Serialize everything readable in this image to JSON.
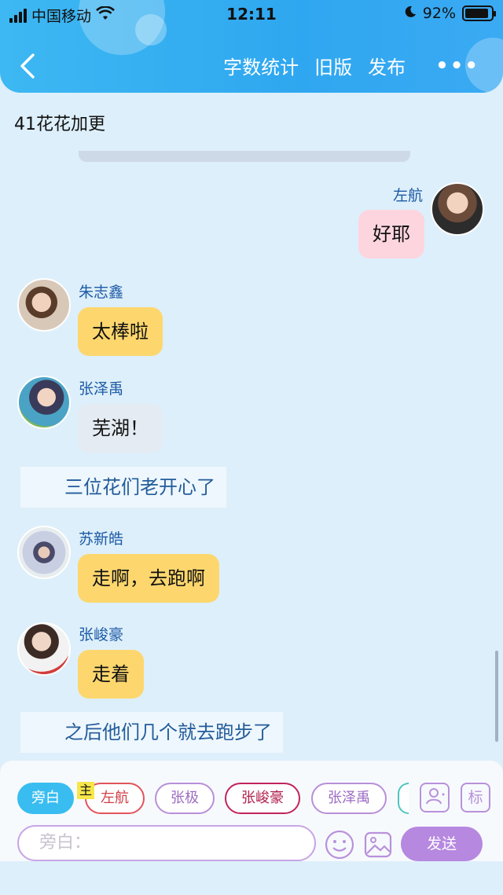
{
  "status_bar": {
    "carrier": "中国移动",
    "time": "12:11",
    "battery": "92%",
    "battery_level": 0.92
  },
  "nav": {
    "actions": [
      "字数统计",
      "旧版",
      "发布"
    ],
    "more": "•••"
  },
  "chapter_title": "41花花加更",
  "messages": [
    {
      "type": "right",
      "name": "左航",
      "text": "好耶",
      "color": "pink"
    },
    {
      "type": "left",
      "name": "朱志鑫",
      "text": "太棒啦",
      "color": "yellow"
    },
    {
      "type": "left",
      "name": "张泽禹",
      "text": "芜湖！",
      "color": "gray"
    },
    {
      "type": "narration",
      "text": "三位花们老开心了"
    },
    {
      "type": "left",
      "name": "苏新皓",
      "text": "走啊，去跑啊",
      "color": "yellow"
    },
    {
      "type": "left",
      "name": "张峻豪",
      "text": "走着",
      "color": "yellow"
    },
    {
      "type": "narration",
      "text": "之后他们几个就去跑步了"
    }
  ],
  "roles": [
    "旁白",
    "左航",
    "张极",
    "张峻豪",
    "张泽禹"
  ],
  "host_tag": "主",
  "icon_buttons": {
    "role_icon": "person-chat-icon",
    "tag_label": "标"
  },
  "input": {
    "placeholder": "旁白："
  },
  "send_label": "发送",
  "colors": {
    "header": "#2fa7f0",
    "send": "#b688e0",
    "active_chip": "#39bdf0"
  }
}
